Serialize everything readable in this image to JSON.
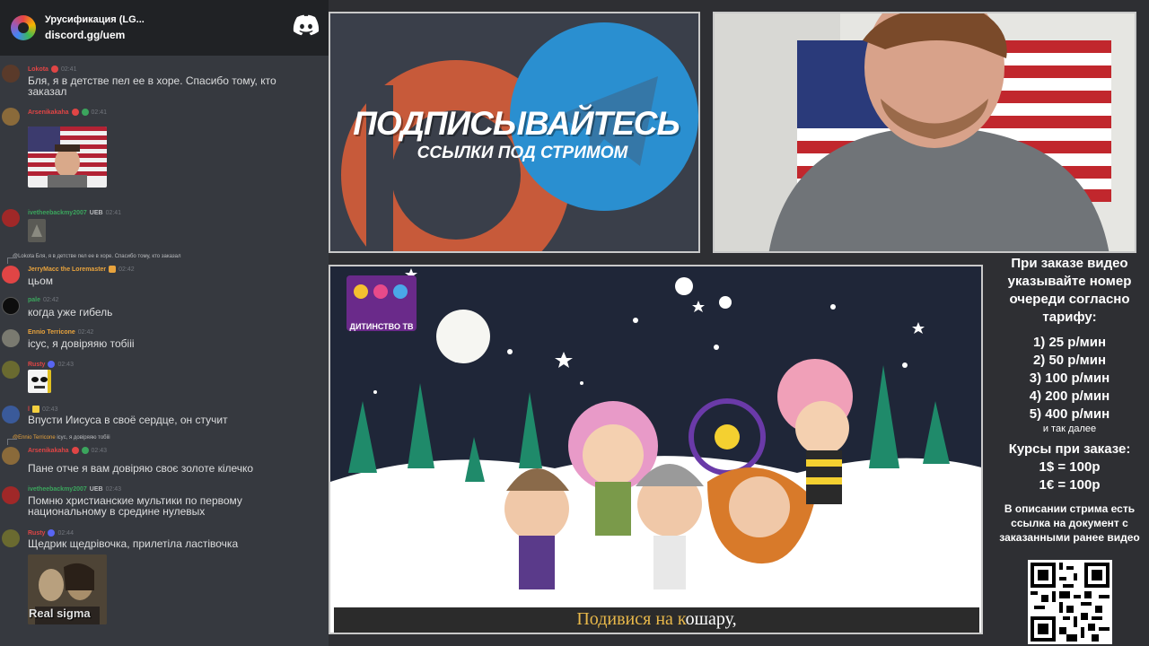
{
  "server": {
    "name": "Урусификация (LG...",
    "invite": "discord.gg/uem"
  },
  "messages": [
    {
      "user": "Lokota",
      "user_color": "#e04545",
      "time": "02:41",
      "text": "Бля, я в детстве пел ее в хоре. Спасибо тому, кто заказал"
    },
    {
      "user": "Arsenikakaha",
      "user_color": "#e04545",
      "time": "02:41"
    },
    {
      "user": "ivetheebackmy2007",
      "user_color": "#3ba55d",
      "tag": "UEB",
      "time": "02:41"
    },
    {
      "reply_user": "@Lokota",
      "reply_text": "Бля, я в детстве пел ее в хоре. Спасибо тому, кто заказал",
      "user": "JerryMacc the Loremaster",
      "user_color": "#e8a33d",
      "time": "02:42",
      "text": "цьом"
    },
    {
      "user": "pale",
      "user_color": "#3ba55d",
      "time": "02:42",
      "text": "когда уже гибель"
    },
    {
      "user": "Ennio Terricone",
      "user_color": "#e8a33d",
      "time": "02:42",
      "text": "ісус, я довіряяю тобііі"
    },
    {
      "user": "Rusty",
      "user_color": "#e04545",
      "time": "02:43"
    },
    {
      "user": "l",
      "user_color": "#e04545",
      "time": "02:43",
      "text": "Впусти Иисуса в своё сердце, он стучит"
    },
    {
      "reply_user": "@Ennio Terricone",
      "reply_text": "ісус, я довіряяю тобііі",
      "user": "Arsenikakaha",
      "user_color": "#e04545",
      "time": "02:43",
      "text": "Пане отче я вам довіряю своє золоте кілечко"
    },
    {
      "user": "ivetheebackmy2007",
      "user_color": "#3ba55d",
      "tag": "UEB",
      "time": "02:43",
      "text": "Помню христианские мультики по первому национальному в средине нулевых"
    },
    {
      "user": "Rusty",
      "user_color": "#e04545",
      "time": "02:44",
      "text": "Щедрик щедрівочка, прилетіла ластівочка"
    }
  ],
  "sigma_caption": "Real sigma",
  "promo": {
    "title": "ПОДПИСЫВАЙТЕСЬ",
    "subtitle": "ССЫЛКИ ПОД СТРИМОМ"
  },
  "video": {
    "channel_label": "ДИТИНСТВО ТВ",
    "subtitle_highlight": "Подивися на к",
    "subtitle_rest": "ошару,"
  },
  "info": {
    "order_text": "При заказе видео указывайте номер очереди согласно тарифу:",
    "tariffs": [
      "1) 25 р/мин",
      "2) 50 р/мин",
      "3) 100 р/мин",
      "4) 200 р/мин",
      "5) 400 р/мин"
    ],
    "tariff_more": "и так далее",
    "rates_title": "Курсы при заказе:",
    "rates": [
      "1$ = 100р",
      "1€ = 100р"
    ],
    "description": "В описании стрима есть ссылка на документ с заказанными ранее видео"
  }
}
